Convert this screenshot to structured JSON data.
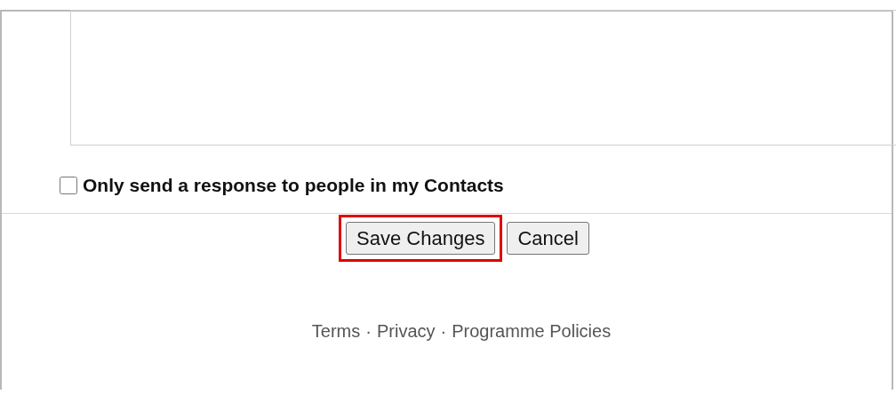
{
  "contacts_only": {
    "label": "Only send a response to people in my Contacts",
    "checked": false
  },
  "buttons": [
    {
      "label": "Save Changes",
      "highlighted": true
    },
    {
      "label": "Cancel",
      "highlighted": false
    }
  ],
  "footer": {
    "separator": "·",
    "links": [
      "Terms",
      "Privacy",
      "Programme Policies"
    ]
  }
}
